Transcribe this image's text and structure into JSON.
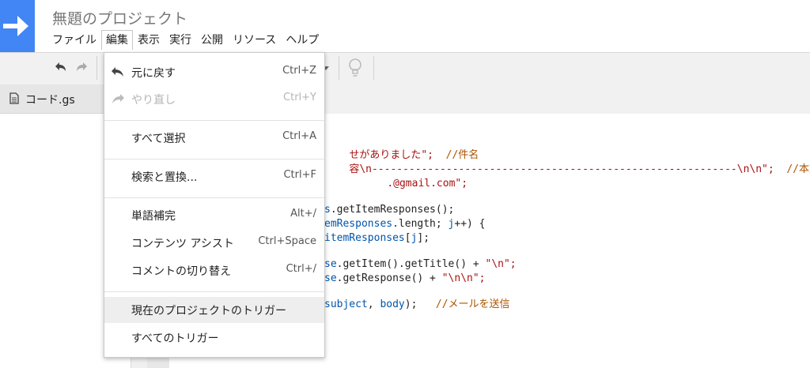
{
  "header": {
    "title": "無題のプロジェクト",
    "menu": [
      {
        "label": "ファイル"
      },
      {
        "label": "編集",
        "active": true
      },
      {
        "label": "表示"
      },
      {
        "label": "実行"
      },
      {
        "label": "公開"
      },
      {
        "label": "リソース"
      },
      {
        "label": "ヘルプ"
      }
    ]
  },
  "file_panel": {
    "file_name": "コード.gs"
  },
  "edit_menu": {
    "items": [
      {
        "label": "元に戻す",
        "shortcut": "Ctrl+Z"
      },
      {
        "label": "やり直し",
        "shortcut": "Ctrl+Y"
      },
      {
        "label": "すべて選択",
        "shortcut": "Ctrl+A"
      },
      {
        "label": "検索と置換...",
        "shortcut": "Ctrl+F"
      },
      {
        "label": "単語補完",
        "shortcut": "Alt+/"
      },
      {
        "label": "コンテンツ アシスト",
        "shortcut": "Ctrl+Space"
      },
      {
        "label": "コメントの切り替え",
        "shortcut": "Ctrl+/"
      },
      {
        "label": "現在のプロジェクトのトリガー",
        "shortcut": ""
      },
      {
        "label": "すべてのトリガー",
        "shortcut": ""
      }
    ]
  },
  "code": {
    "l1_str": "せがありました\";",
    "l1_cmt": "//件名",
    "l2_str": "容\\n-----------------------------------------------------------\\n\\n\";",
    "l2_cmt": "//本文",
    "l3_str": ".@gmail.com\";",
    "l5_a": "s",
    "l5_b": ".getItemResponses();",
    "l6_a": "emResponses",
    "l6_b": ".length; ",
    "l6_c": "j",
    "l6_d": "++) {",
    "l7_a": "itemResponses",
    "l7_b": "[",
    "l7_c": "j",
    "l7_d": "];",
    "l9_a": "se",
    "l9_b": ".getItem().getTitle() + ",
    "l9_c": "\"\\n\";",
    "l10_a": "se",
    "l10_b": ".getResponse() + ",
    "l10_c": "\"\\n\\n\";",
    "l12_a": "subject",
    "l12_b": ", ",
    "l12_c": "body",
    "l12_d": ");",
    "l12_cmt": "//メールを送信"
  },
  "colors": {
    "brand": "#4285f4",
    "string": "#aa1111",
    "variable": "#0055aa",
    "comment": "#aa5500"
  },
  "icons": [
    "arrow-right-icon",
    "undo-icon",
    "redo-icon",
    "dropdown-caret-icon",
    "lightbulb-icon",
    "document-icon"
  ]
}
